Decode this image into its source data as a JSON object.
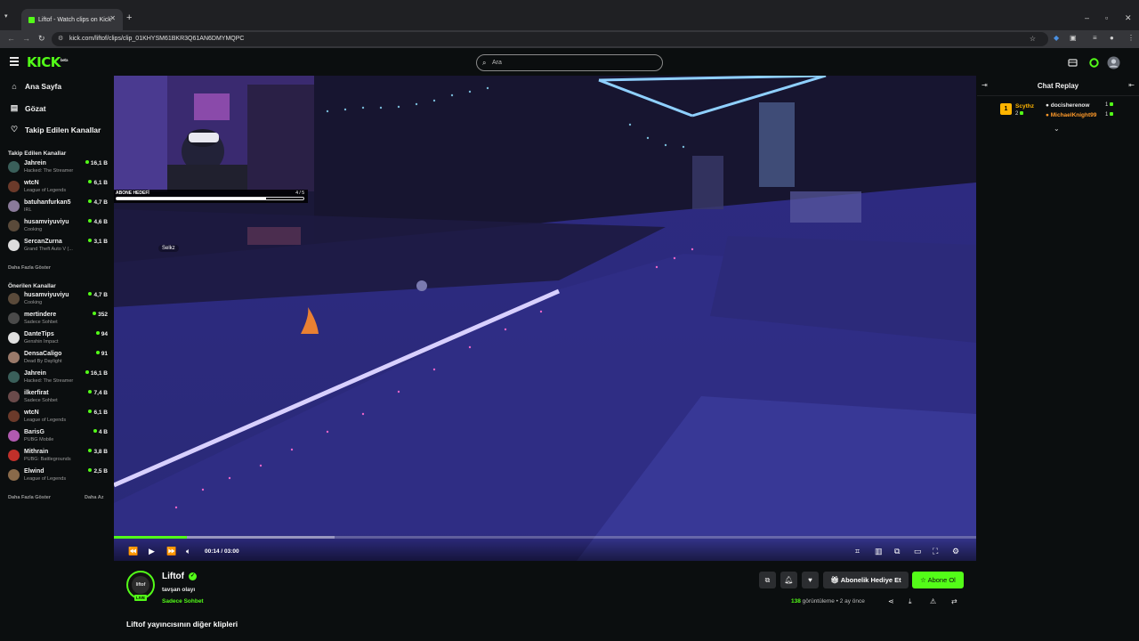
{
  "browser": {
    "tab_title": "Liftof - Watch clips on Kick",
    "url": "kick.com/liftof/clips/clip_01KHYSM61BKR3Q61AN6DMYMQPC"
  },
  "header": {
    "logo": "KICK",
    "logo_sup": "beta",
    "search_placeholder": "Ara"
  },
  "sidebar": {
    "nav": [
      {
        "label": "Ana Sayfa",
        "icon": "home-icon"
      },
      {
        "label": "Gözat",
        "icon": "browse-icon"
      },
      {
        "label": "Takip Edilen Kanallar",
        "icon": "heart-icon"
      }
    ],
    "followed_title": "Takip Edilen Kanallar",
    "followed": [
      {
        "name": "Jahrein",
        "category": "Hacked: The Streamer",
        "viewers": "16,1 B",
        "color": "#3a5f5a"
      },
      {
        "name": "wtcN",
        "category": "League of Legends",
        "viewers": "6,1 B",
        "color": "#6b3a2a"
      },
      {
        "name": "batuhanfurkan5",
        "category": "IRL",
        "viewers": "4,7 B",
        "color": "#8a7a9a"
      },
      {
        "name": "husamviyuviyu",
        "category": "Cooking",
        "viewers": "4,6 B",
        "color": "#5a4a3a"
      },
      {
        "name": "SercanZurna",
        "category": "Grand Theft Auto V (...",
        "viewers": "3,1 B",
        "color": "#dddddd"
      }
    ],
    "followed_more": "Daha Fazla Göster",
    "recommended_title": "Önerilen Kanallar",
    "recommended": [
      {
        "name": "husamviyuviyu",
        "category": "Cooking",
        "viewers": "4,7 B",
        "color": "#5a4a3a"
      },
      {
        "name": "mertindere",
        "category": "Sadece Sohbet",
        "viewers": "352",
        "color": "#4a4a4a"
      },
      {
        "name": "DanteTips",
        "category": "Genshin Impact",
        "viewers": "94",
        "color": "#e0e0e0"
      },
      {
        "name": "DensaCaligo",
        "category": "Dead By Daylight",
        "viewers": "91",
        "color": "#9a7a6a"
      },
      {
        "name": "Jahrein",
        "category": "Hacked: The Streamer",
        "viewers": "16,1 B",
        "color": "#3a5f5a"
      },
      {
        "name": "ilkerfirat",
        "category": "Sadece Sohbet",
        "viewers": "7,4 B",
        "color": "#6a4a4a"
      },
      {
        "name": "wtcN",
        "category": "League of Legends",
        "viewers": "6,1 B",
        "color": "#6b3a2a"
      },
      {
        "name": "BarisG",
        "category": "PUBG Mobile",
        "viewers": "4 B",
        "color": "#b05ab0"
      },
      {
        "name": "Mithrain",
        "category": "PUBG: Battlegrounds",
        "viewers": "3,8 B",
        "color": "#c0302a"
      },
      {
        "name": "Elwind",
        "category": "League of Legends",
        "viewers": "2,5 B",
        "color": "#8a6a4a"
      }
    ],
    "rec_more": "Daha Fazla Göster",
    "rec_less": "Daha Az"
  },
  "video": {
    "sub_goal_label": "ABONE HEDEFİ",
    "sub_goal_count": "4 / 5",
    "sub_goal_progress": 0.8,
    "time": "00:14 / 03:00",
    "progress": 0.0843,
    "buffered": 0.256,
    "overlay_tag": "Selkz"
  },
  "info": {
    "channel_name": "Liftof",
    "avatar_text": "liftof",
    "live_badge": "LIVE",
    "clip_title": "tavşan olayı",
    "category": "Sadece Sohbet",
    "gift_label": "Abonelik Hediye Et",
    "subscribe_label": "Abone Ol",
    "views_count": "138",
    "views_label": "görüntüleme",
    "separator": "•",
    "time_ago": "2 ay önce",
    "other_clips": "Liftof yayıncısının diğer klipleri"
  },
  "chat": {
    "title": "Chat Replay",
    "top_gifter": {
      "rank": "1",
      "name": "Scythz",
      "count": "2"
    },
    "gifters": [
      {
        "name": "docisherenow",
        "count": "1",
        "color": "#e8e8e8"
      },
      {
        "name": "MichaelKnight99",
        "count": "1",
        "color": "#ff9a2a"
      }
    ]
  },
  "colors": {
    "accent": "#53fc18",
    "background": "#0b0e0f"
  }
}
